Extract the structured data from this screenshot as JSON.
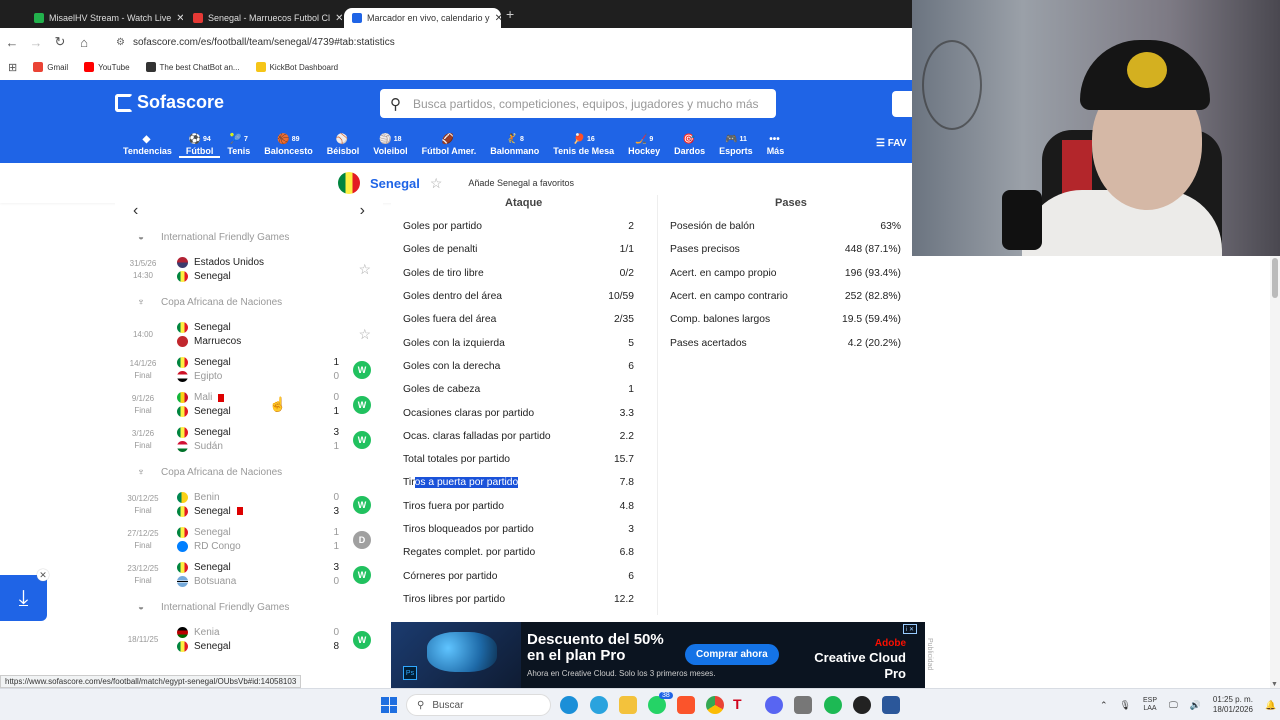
{
  "browser": {
    "tabs": [
      {
        "title": "MisaelHV Stream - Watch Live",
        "active": false,
        "color": "#22b14c"
      },
      {
        "title": "Senegal - Marruecos Futbol Cl",
        "active": false,
        "color": "#e53935"
      },
      {
        "title": "Marcador en vivo, calendario y",
        "active": true,
        "color": "#1f64e6"
      }
    ],
    "url": "sofascore.com/es/football/team/senegal/4739#tab:statistics",
    "bookmarks": [
      {
        "label": "Gmail",
        "color": "#ea4335"
      },
      {
        "label": "YouTube",
        "color": "#ff0000"
      },
      {
        "label": "The best ChatBot an...",
        "color": "#333333"
      },
      {
        "label": "KickBot Dashboard",
        "color": "#f5c518"
      }
    ],
    "status_url": "https://www.sofascore.com/es/football/match/egypt-senegal/OUbsVb#id:14058103"
  },
  "header": {
    "logo": "Sofascore",
    "search_placeholder": "Busca partidos, competiciones, equipos, jugadores y mucho más",
    "fav_label": "FAV",
    "sports": [
      {
        "label": "Tendencias",
        "count": "",
        "icon": "◆",
        "active": false
      },
      {
        "label": "Fútbol",
        "count": "94",
        "icon": "⚽",
        "active": true
      },
      {
        "label": "Tenis",
        "count": "7",
        "icon": "🎾",
        "active": false
      },
      {
        "label": "Baloncesto",
        "count": "89",
        "icon": "🏀",
        "active": false
      },
      {
        "label": "Béisbol",
        "count": "",
        "icon": "⚾",
        "active": false
      },
      {
        "label": "Voleibol",
        "count": "18",
        "icon": "🏐",
        "active": false
      },
      {
        "label": "Fútbol Amer.",
        "count": "",
        "icon": "🏈",
        "active": false
      },
      {
        "label": "Balonmano",
        "count": "8",
        "icon": "🤾",
        "active": false
      },
      {
        "label": "Tenis de Mesa",
        "count": "16",
        "icon": "🏓",
        "active": false
      },
      {
        "label": "Hockey",
        "count": "9",
        "icon": "🏒",
        "active": false
      },
      {
        "label": "Dardos",
        "count": "",
        "icon": "🎯",
        "active": false
      },
      {
        "label": "Esports",
        "count": "11",
        "icon": "🎮",
        "active": false
      },
      {
        "label": "Más",
        "count": "",
        "icon": "•••",
        "active": false
      }
    ]
  },
  "team": {
    "name": "Senegal",
    "favorite_text": "Añade Senegal a favoritos"
  },
  "matches": {
    "groups": [
      {
        "competition": "International Friendly Games",
        "icon": "globe",
        "items": [
          {
            "date": "31/5/26",
            "time": "14:30",
            "home": "Estados Unidos",
            "home_flag": "us",
            "away": "Senegal",
            "away_flag": "sn",
            "hs": "",
            "as": "",
            "result": "",
            "home_lost": false,
            "away_lost": false,
            "star": true
          }
        ]
      },
      {
        "competition": "Copa Africana de Naciones",
        "icon": "trophy",
        "items": [
          {
            "date": "",
            "time": "14:00",
            "home": "Senegal",
            "home_flag": "sn",
            "away": "Marruecos",
            "away_flag": "ma",
            "hs": "",
            "as": "",
            "result": "",
            "home_lost": false,
            "away_lost": false,
            "star": true
          },
          {
            "date": "14/1/26",
            "time": "Final",
            "home": "Senegal",
            "home_flag": "sn",
            "away": "Egipto",
            "away_flag": "eg",
            "hs": "1",
            "as": "0",
            "result": "W",
            "home_lost": false,
            "away_lost": true,
            "star": false
          },
          {
            "date": "9/1/26",
            "time": "Final",
            "home": "Mali",
            "home_flag": "ml",
            "away": "Senegal",
            "away_flag": "sn",
            "hs": "0",
            "as": "1",
            "result": "W",
            "home_lost": true,
            "away_lost": false,
            "star": false,
            "home_card": true
          },
          {
            "date": "3/1/26",
            "time": "Final",
            "home": "Senegal",
            "home_flag": "sn",
            "away": "Sudán",
            "away_flag": "sd",
            "hs": "3",
            "as": "1",
            "result": "W",
            "home_lost": false,
            "away_lost": true,
            "star": false
          }
        ]
      },
      {
        "competition": "Copa Africana de Naciones",
        "icon": "trophy",
        "items": [
          {
            "date": "30/12/25",
            "time": "Final",
            "home": "Benin",
            "home_flag": "bj",
            "away": "Senegal",
            "away_flag": "sn",
            "hs": "0",
            "as": "3",
            "result": "W",
            "home_lost": true,
            "away_lost": false,
            "star": false,
            "away_card": true
          },
          {
            "date": "27/12/25",
            "time": "Final",
            "home": "Senegal",
            "home_flag": "sn",
            "away": "RD Congo",
            "away_flag": "cd",
            "hs": "1",
            "as": "1",
            "result": "D",
            "home_lost": true,
            "away_lost": true,
            "star": false
          },
          {
            "date": "23/12/25",
            "time": "Final",
            "home": "Senegal",
            "home_flag": "sn",
            "away": "Botsuana",
            "away_flag": "bw",
            "hs": "3",
            "as": "0",
            "result": "W",
            "home_lost": false,
            "away_lost": true,
            "star": false
          }
        ]
      },
      {
        "competition": "International Friendly Games",
        "icon": "globe",
        "items": [
          {
            "date": "18/11/25",
            "time": "",
            "home": "Kenia",
            "home_flag": "ke",
            "away": "Senegal",
            "away_flag": "sn",
            "hs": "0",
            "as": "8",
            "result": "W",
            "home_lost": true,
            "away_lost": false,
            "star": false
          }
        ]
      }
    ]
  },
  "stats": {
    "attack_title": "Ataque",
    "passes_title": "Pases",
    "attack": [
      {
        "label": "Goles por partido",
        "value": "2"
      },
      {
        "label": "Goles de penalti",
        "value": "1/1"
      },
      {
        "label": "Goles de tiro libre",
        "value": "0/2"
      },
      {
        "label": "Goles dentro del área",
        "value": "10/59"
      },
      {
        "label": "Goles fuera del área",
        "value": "2/35"
      },
      {
        "label": "Goles con la izquierda",
        "value": "5"
      },
      {
        "label": "Goles con la derecha",
        "value": "6"
      },
      {
        "label": "Goles de cabeza",
        "value": "1"
      },
      {
        "label": "Ocasiones claras por partido",
        "value": "3.3"
      },
      {
        "label": "Ocas. claras falladas por partido",
        "value": "2.2"
      },
      {
        "label": "Total totales por partido",
        "value": "15.7"
      },
      {
        "label": "Tiros a puerta por partido",
        "value": "7.8",
        "highlight_prefix": "Tir",
        "highlight_rest": "os a puerta por partido"
      },
      {
        "label": "Tiros fuera por partido",
        "value": "4.8"
      },
      {
        "label": "Tiros bloqueados por partido",
        "value": "3"
      },
      {
        "label": "Regates complet. por partido",
        "value": "6.8"
      },
      {
        "label": "Córneres por partido",
        "value": "6"
      },
      {
        "label": "Tiros libres por partido",
        "value": "12.2"
      }
    ],
    "passes": [
      {
        "label": "Posesión de balón",
        "value": "63%"
      },
      {
        "label": "Pases precisos",
        "value": "448 (87.1%)"
      },
      {
        "label": "Acert. en campo propio",
        "value": "196 (93.4%)"
      },
      {
        "label": "Acert. en campo contrario",
        "value": "252 (82.8%)"
      },
      {
        "label": "Comp. balones largos",
        "value": "19.5 (59.4%)"
      },
      {
        "label": "Pases acertados",
        "value": "4.2 (20.2%)"
      }
    ]
  },
  "ad": {
    "title": "Descuento del 50% en el plan Pro",
    "subtitle": "Ahora en Creative Cloud. Solo los 3 primeros meses.",
    "button": "Comprar ahora",
    "brand_top": "Adobe",
    "brand": "Creative Cloud Pro",
    "publicidad": "Publicidad",
    "ps_label": "Ps"
  },
  "taskbar": {
    "search": "Buscar",
    "lang_top": "ESP",
    "lang_bottom": "LAA",
    "time": "01:25 p. m.",
    "date": "18/01/2026",
    "whatsapp_badge": "38"
  }
}
